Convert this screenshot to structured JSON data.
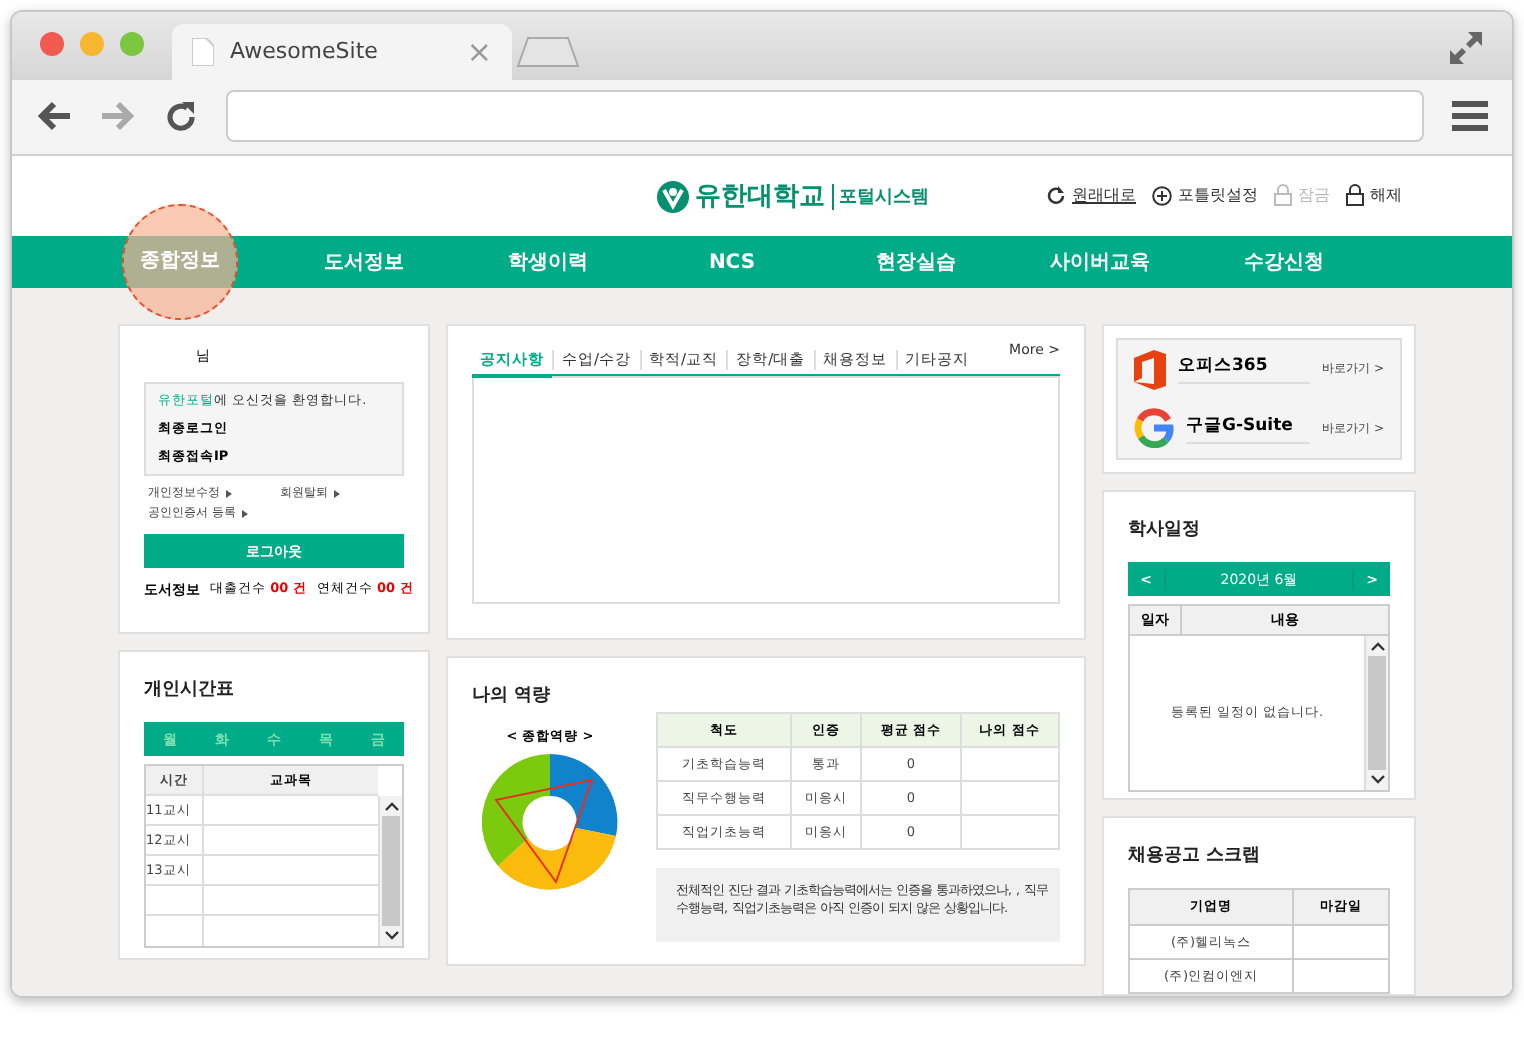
{
  "browser": {
    "tab_title": "AwesomeSite",
    "tab_close": "×"
  },
  "header": {
    "logo_text": "유한대학교",
    "logo_sub": "포털시스템",
    "links": [
      {
        "label": "원래대로",
        "kind": "refresh",
        "disabled": false
      },
      {
        "label": "포틀릿설정",
        "kind": "plus",
        "disabled": false
      },
      {
        "label": "잠금",
        "kind": "lock",
        "disabled": true
      },
      {
        "label": "해제",
        "kind": "lock",
        "disabled": false
      }
    ]
  },
  "nav": [
    {
      "label": "종합정보",
      "selected": true
    },
    {
      "label": "도서정보",
      "selected": false
    },
    {
      "label": "학생이력",
      "selected": false
    },
    {
      "label": "NCS",
      "selected": false
    },
    {
      "label": "현장실습",
      "selected": false
    },
    {
      "label": "사이버교육",
      "selected": false
    },
    {
      "label": "수강신청",
      "selected": false
    }
  ],
  "login_card": {
    "greeting": "님",
    "welcome_brand": "유한포털",
    "welcome_rest": "에 오신것을 환영합니다.",
    "fields": [
      "최종로그인",
      "최종접속IP"
    ],
    "links": [
      "개인정보수정",
      "회원탈퇴",
      "공인인증서 등록"
    ],
    "logout": "로그아웃",
    "library": {
      "label": "도서정보",
      "items": [
        {
          "label": "대출건수",
          "value": "00 건"
        },
        {
          "label": "연체건수",
          "value": "00 건"
        }
      ]
    }
  },
  "notice": {
    "tabs": [
      {
        "label": "공지사항",
        "selected": true
      },
      {
        "label": "수업/수강",
        "selected": false
      },
      {
        "label": "학적/교직",
        "selected": false
      },
      {
        "label": "장학/대출",
        "selected": false
      },
      {
        "label": "채용정보",
        "selected": false
      },
      {
        "label": "기타공지",
        "selected": false
      }
    ],
    "more": "More >"
  },
  "timetable": {
    "title": "개인시간표",
    "days": [
      "월",
      "화",
      "수",
      "목",
      "금"
    ],
    "columns": [
      "시간",
      "교과목"
    ],
    "rows": [
      "11교시",
      "12교시",
      "13교시"
    ]
  },
  "competency": {
    "title": "나의 역량",
    "chart_label": "< 종합역량 >",
    "columns": [
      "척도",
      "인증",
      "평균 점수",
      "나의 점수"
    ],
    "rows": [
      {
        "scale": "기초학습능력",
        "cert": "통과",
        "avg": "0"
      },
      {
        "scale": "직무수행능력",
        "cert": "미응시",
        "avg": "0"
      },
      {
        "scale": "직업기초능력",
        "cert": "미응시",
        "avg": "0"
      }
    ],
    "note": "전체적인 진단 결과 기초학습능력에서는 인증을 통과하였으나, , 직무수행능력, 직업기초능력은 아직 인증이 되지 않은 상황입니다."
  },
  "quick_links": [
    {
      "kind": "office",
      "label": "오피스365",
      "action": "바로가기 >"
    },
    {
      "kind": "google",
      "label": "구글G-Suite",
      "action": "바로가기 >"
    }
  ],
  "calendar": {
    "title": "학사일정",
    "prev": "<",
    "month": "2020년 6월",
    "next": ">",
    "columns": [
      "일자",
      "내용"
    ],
    "empty": "등록된 일정이 없습니다."
  },
  "jobs": {
    "title": "채용공고 스크랩",
    "columns": [
      "기업명",
      "마감일"
    ],
    "rows": [
      "(주)헬리녹스",
      "(주)인컴이엔지"
    ]
  }
}
